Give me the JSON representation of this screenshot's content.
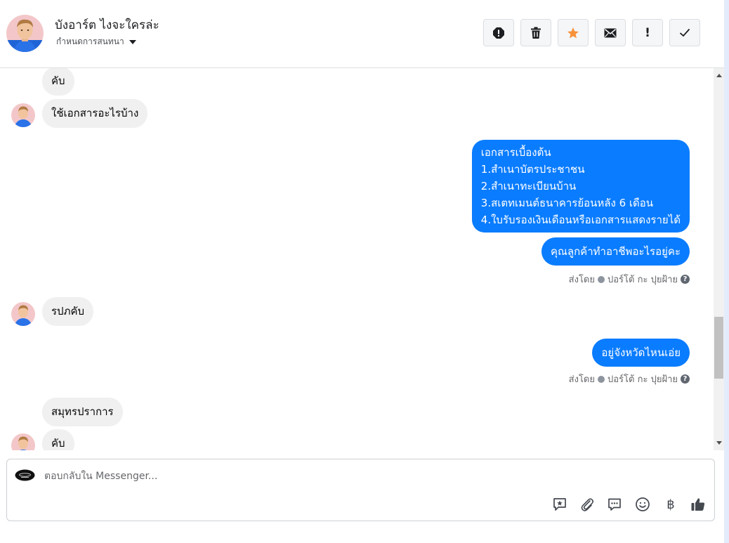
{
  "header": {
    "contact_name": "บังอาร์ต ไงจะใครล่ะ",
    "assign_label": "กำหนดการสนทนา",
    "toolbar": {
      "icons": [
        "block-icon",
        "trash-icon",
        "star-icon",
        "envelope-icon",
        "exclamation-icon",
        "check-icon"
      ],
      "star_color": "#f7923b",
      "exclamation_text": "!"
    }
  },
  "messages": [
    {
      "direction": "in",
      "text": "คับ"
    },
    {
      "direction": "in",
      "text": "ใช้เอกสารอะไรบ้าง"
    },
    {
      "direction": "out",
      "lines": [
        "เอกสารเบื้องต้น",
        "1.สำเนาบัตรประชาชน",
        "2.สำเนาทะเบียนบ้าน",
        "3.สเตทเมนต์ธนาคารย้อนหลัง 6 เดือน",
        "4.ใบรับรองเงินเดือนหรือเอกสารแสดงรายได้"
      ]
    },
    {
      "direction": "out",
      "text": "คุณลูกค้าทำอาชีพอะไรอยู่คะ"
    },
    {
      "direction": "meta",
      "sent_by_prefix": "ส่งโดย",
      "sent_by_name": "ปอร์โต้ กะ ปุยฝ้าย",
      "help": "?"
    },
    {
      "direction": "in",
      "text": "รปภคับ"
    },
    {
      "direction": "out",
      "text": "อยู่จังหวัดไหนเอ่ย"
    },
    {
      "direction": "meta",
      "sent_by_prefix": "ส่งโดย",
      "sent_by_name": "ปอร์โต้ กะ ปุยฝ้าย",
      "help": "?"
    },
    {
      "direction": "in",
      "text": "สมุทรปราการ"
    },
    {
      "direction": "in",
      "text": "คับ"
    }
  ],
  "composer": {
    "placeholder": "ตอบกลับใน Messenger...",
    "value": "",
    "icons": [
      "saved-reply-icon",
      "attachment-icon",
      "chat-bubble-icon",
      "emoji-icon",
      "baht-icon",
      "thumbs-up-icon"
    ],
    "baht_symbol": "฿"
  },
  "colors": {
    "outgoing_bubble": "#0a7cff",
    "incoming_bubble": "#f0f0f0"
  }
}
